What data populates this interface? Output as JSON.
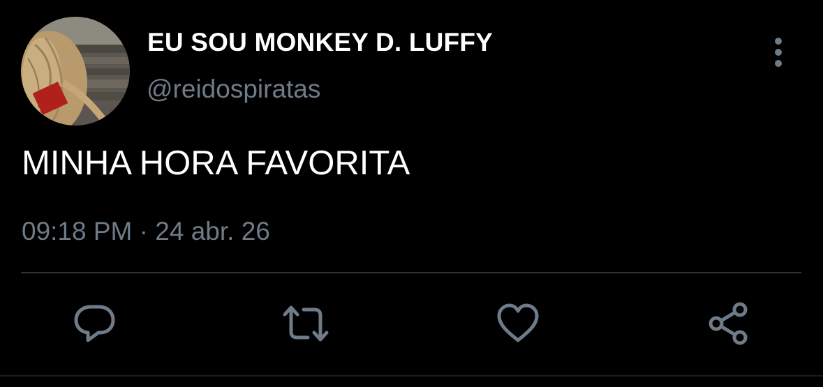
{
  "tweet": {
    "author": {
      "display_name": "EU SOU MONKEY D. LUFFY",
      "handle": "@reidospiratas",
      "avatar_icon": "straw-hat-avatar"
    },
    "text": "MINHA HORA FAVORITA",
    "time": "09:18 PM",
    "separator": "·",
    "date": "24 abr. 26",
    "more_icon": "more-vertical-icon"
  },
  "actions": [
    {
      "name": "reply",
      "icon": "reply-icon"
    },
    {
      "name": "retweet",
      "icon": "retweet-icon"
    },
    {
      "name": "like",
      "icon": "heart-icon"
    },
    {
      "name": "share",
      "icon": "share-icon"
    }
  ],
  "colors": {
    "background": "#000000",
    "primary_text": "#ffffff",
    "secondary_text": "#6e7b88",
    "divider": "#2f3336"
  }
}
